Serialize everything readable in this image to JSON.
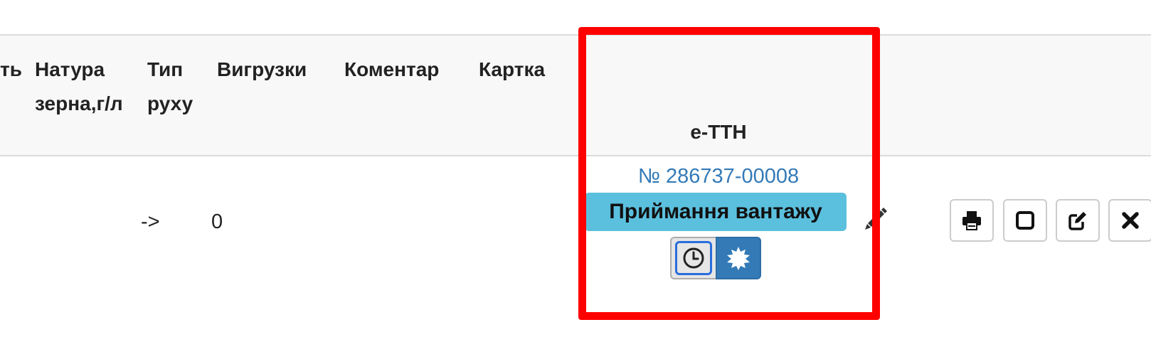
{
  "table": {
    "headers": {
      "cut_prev": "ть",
      "natura": "Натура зерна,г/л",
      "typ": "Тип руху",
      "vygruzky": "Вигрузки",
      "komentar": "Коментар",
      "kartka": "Картка",
      "ettn": "е-ТТН"
    },
    "row": {
      "typ_value": "->",
      "vygruzky_value": "0",
      "ettn_number": "№ 286737-00008",
      "ettn_status": "Приймання вантажу"
    }
  },
  "icons": {
    "history": "clock-icon",
    "badge": "certificate-icon",
    "edit_ettn": "pencil-icon",
    "actions": [
      "print-icon",
      "square-icon",
      "edit-icon",
      "close-icon"
    ]
  },
  "colors": {
    "link": "#337ab7",
    "status_label_bg": "#5bc0de",
    "primary_button": "#337ab7",
    "highlight": "#ff0000"
  }
}
